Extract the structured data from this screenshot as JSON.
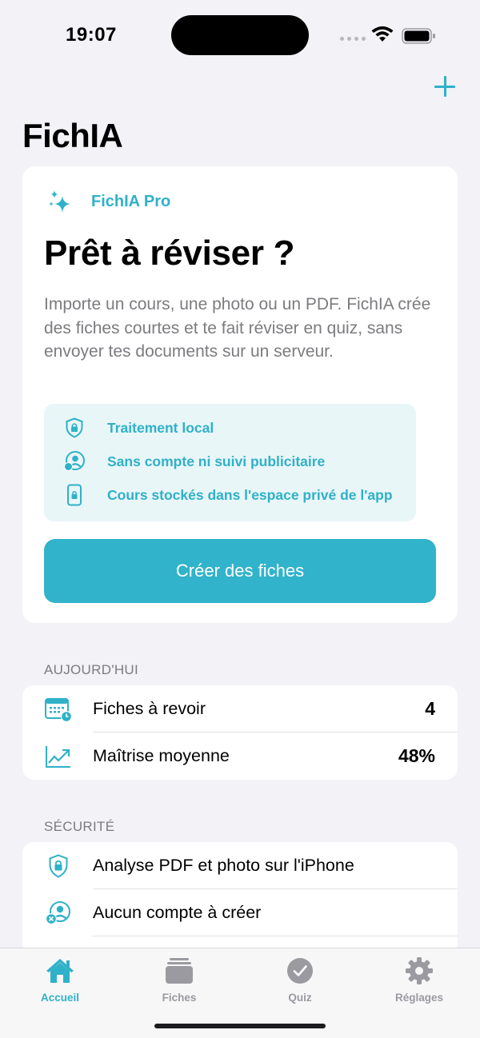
{
  "status_bar": {
    "time": "19:07"
  },
  "header": {
    "title": "FichIA"
  },
  "hero": {
    "badge": "FichIA Pro",
    "title": "Prêt à réviser ?",
    "description": "Importe un cours, une photo ou un PDF. FichIA crée des fiches courtes et te fait réviser en quiz, sans envoyer tes documents sur un serveur.",
    "features": [
      {
        "icon": "shield-lock-icon",
        "label": "Traitement local"
      },
      {
        "icon": "person-badge-icon",
        "label": "Sans compte ni suivi publicitaire"
      },
      {
        "icon": "phone-lock-icon",
        "label": "Cours stockés dans l'espace privé de l'app"
      }
    ],
    "button": "Créer des fiches"
  },
  "today": {
    "header": "AUJOURD'HUI",
    "rows": [
      {
        "icon": "calendar-clock-icon",
        "label": "Fiches à revoir",
        "value": "4"
      },
      {
        "icon": "chart-trend-icon",
        "label": "Maîtrise moyenne",
        "value": "48%"
      }
    ]
  },
  "security": {
    "header": "SÉCURITÉ",
    "rows": [
      {
        "icon": "shield-lock-icon",
        "label": "Analyse PDF et photo sur l'iPhone"
      },
      {
        "icon": "person-x-icon",
        "label": "Aucun compte à créer"
      }
    ]
  },
  "tabs": [
    {
      "icon": "home-icon",
      "label": "Accueil",
      "active": true
    },
    {
      "icon": "stack-icon",
      "label": "Fiches",
      "active": false
    },
    {
      "icon": "checkmark-circle-icon",
      "label": "Quiz",
      "active": false
    },
    {
      "icon": "gear-icon",
      "label": "Réglages",
      "active": false
    }
  ],
  "colors": {
    "accent": "#2fb1c9",
    "background": "#f2f2f7",
    "inactive": "#9a9aa0"
  }
}
